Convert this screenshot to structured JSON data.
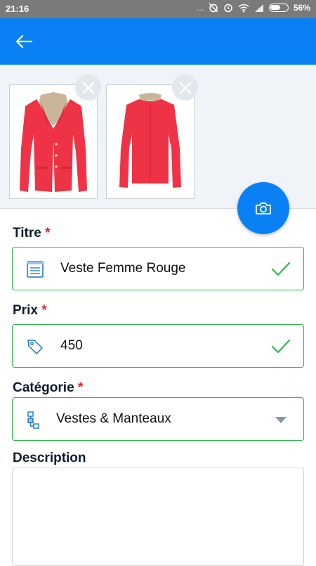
{
  "status_bar": {
    "time": "21:16",
    "dots": "...",
    "battery": "56%"
  },
  "colors": {
    "primary": "#0a80f5",
    "valid": "#2eb84b",
    "required": "#e0262e",
    "jacket": "#ef3346"
  },
  "app_bar": {
    "back_icon": "arrow-left-icon"
  },
  "photos": [
    {
      "name": "jacket-front",
      "remove_icon": "close-icon"
    },
    {
      "name": "jacket-back",
      "remove_icon": "close-icon"
    }
  ],
  "fab": {
    "icon": "camera-icon"
  },
  "fields": {
    "title": {
      "label": "Titre",
      "required_mark": "*",
      "value": "Veste Femme Rouge",
      "icon": "document-icon"
    },
    "price": {
      "label": "Prix",
      "required_mark": "*",
      "value": "450",
      "icon": "price-tag-icon"
    },
    "category": {
      "label": "Catégorie",
      "required_mark": "*",
      "value": "Vestes & Manteaux",
      "icon": "hierarchy-icon"
    },
    "description": {
      "label": "Description",
      "value": ""
    }
  }
}
